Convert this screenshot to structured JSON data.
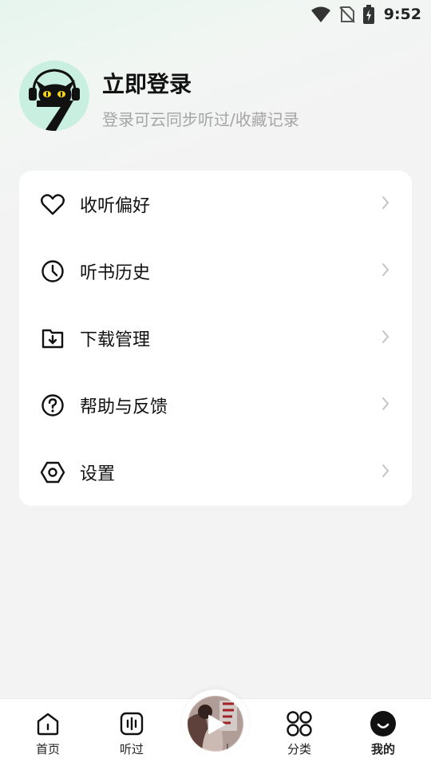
{
  "status_bar": {
    "time": "9:52",
    "icons": [
      "wifi-icon",
      "no-sim-icon",
      "battery-charging-icon"
    ]
  },
  "profile": {
    "title": "立即登录",
    "subtitle": "登录可云同步听过/收藏记录",
    "avatar_icon": "black-cat-headphones-avatar"
  },
  "menu": {
    "items": [
      {
        "label": "收听偏好",
        "icon": "heart-icon"
      },
      {
        "label": "听书历史",
        "icon": "clock-icon"
      },
      {
        "label": "下载管理",
        "icon": "download-folder-icon"
      },
      {
        "label": "帮助与反馈",
        "icon": "question-circle-icon"
      },
      {
        "label": "设置",
        "icon": "hexagon-settings-icon"
      }
    ]
  },
  "tab_bar": {
    "tabs": [
      {
        "label": "首页",
        "icon": "home-icon"
      },
      {
        "label": "听过",
        "icon": "audio-icon"
      },
      {
        "label": "分类",
        "icon": "grid-circles-icon"
      },
      {
        "label": "我的",
        "icon": "profile-circle-icon",
        "active": true
      }
    ],
    "player_icon": "play-icon"
  },
  "colors": {
    "accent_mint": "#c8efdf",
    "text_primary": "#111111",
    "text_secondary": "#a5a5a5",
    "chevron": "#c4c4c4"
  }
}
